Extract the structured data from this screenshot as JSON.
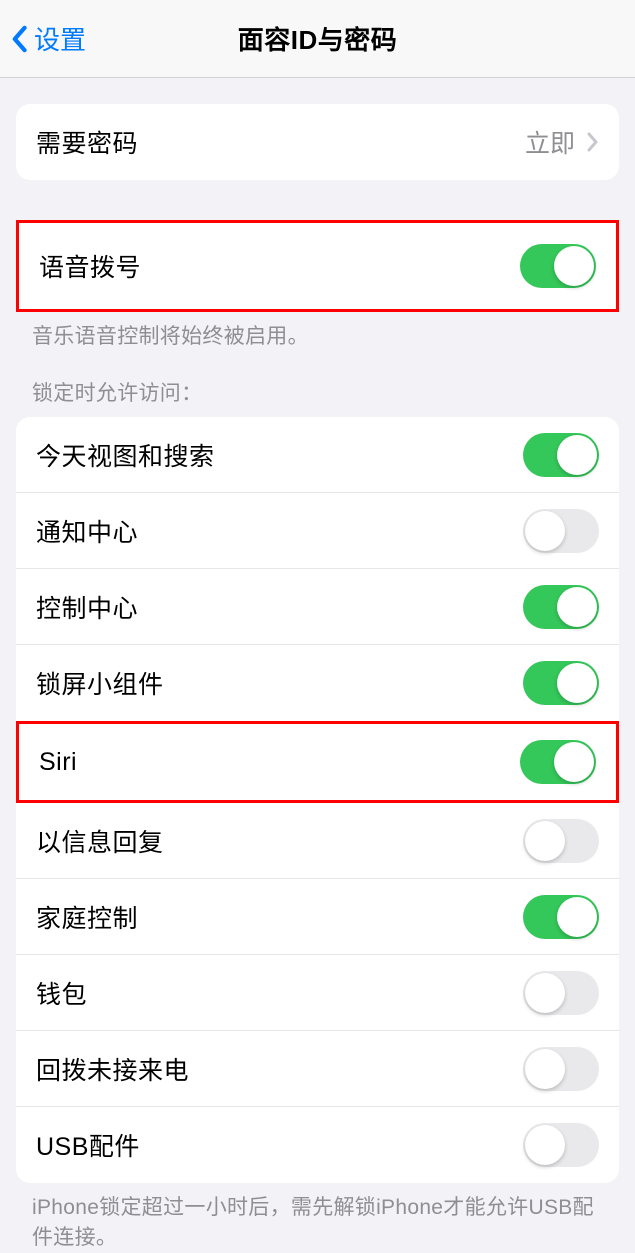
{
  "header": {
    "back_label": "设置",
    "title": "面容ID与密码"
  },
  "passcode_section": {
    "require_passcode_label": "需要密码",
    "require_passcode_value": "立即"
  },
  "voice_section": {
    "voice_dial_label": "语音拨号",
    "voice_dial_on": true,
    "footer": "音乐语音控制将始终被启用。"
  },
  "lock_section": {
    "header": "锁定时允许访问：",
    "items": [
      {
        "label": "今天视图和搜索",
        "on": true,
        "highlighted": false
      },
      {
        "label": "通知中心",
        "on": false,
        "highlighted": false
      },
      {
        "label": "控制中心",
        "on": true,
        "highlighted": false
      },
      {
        "label": "锁屏小组件",
        "on": true,
        "highlighted": false
      },
      {
        "label": "Siri",
        "on": true,
        "highlighted": true
      },
      {
        "label": "以信息回复",
        "on": false,
        "highlighted": false
      },
      {
        "label": "家庭控制",
        "on": true,
        "highlighted": false
      },
      {
        "label": "钱包",
        "on": false,
        "highlighted": false
      },
      {
        "label": "回拨未接来电",
        "on": false,
        "highlighted": false
      },
      {
        "label": "USB配件",
        "on": false,
        "highlighted": false
      }
    ],
    "footer": "iPhone锁定超过一小时后，需先解锁iPhone才能允许USB配件连接。"
  }
}
